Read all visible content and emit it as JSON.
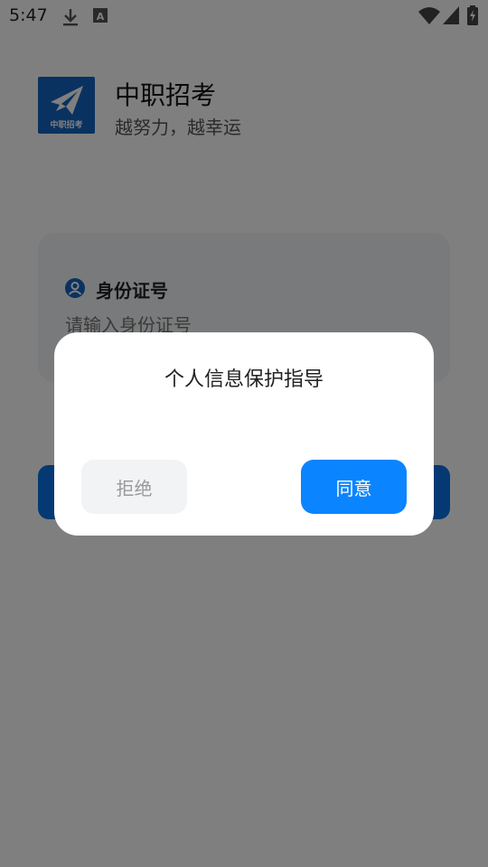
{
  "status_bar": {
    "time": "5:47",
    "icons": [
      "download-icon",
      "accessibility-a-icon",
      "wifi-icon",
      "signal-icon",
      "battery-charging-icon"
    ]
  },
  "header": {
    "logo_text": "中职招考",
    "title": "中职招考",
    "slogan": "越努力，越幸运"
  },
  "form": {
    "id_label": "身份证号",
    "id_placeholder": "请输入身份证号"
  },
  "dialog": {
    "title": "个人信息保护指导",
    "reject_label": "拒绝",
    "agree_label": "同意"
  },
  "colors": {
    "brand_blue": "#1565c0",
    "primary_button": "#0a84ff",
    "overlay": "rgba(0,0,0,0.5)"
  }
}
